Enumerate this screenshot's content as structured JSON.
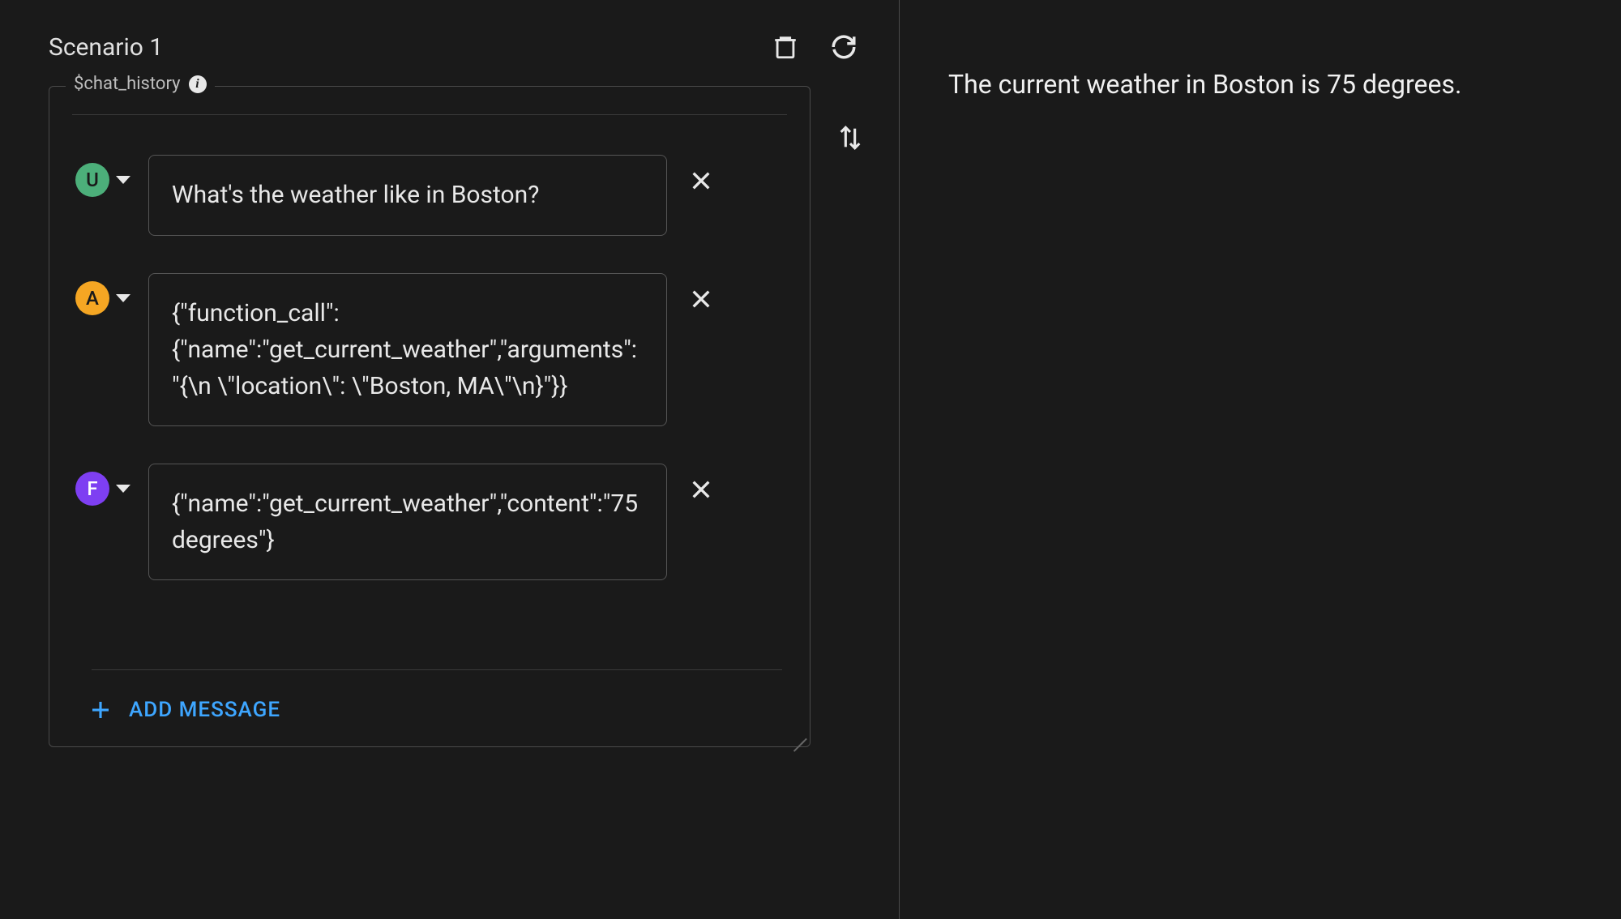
{
  "scenario": {
    "title": "Scenario 1"
  },
  "chat_history": {
    "label": "$chat_history",
    "messages": [
      {
        "role": "user",
        "role_letter": "U",
        "content": "What's the weather like in Boston?"
      },
      {
        "role": "assistant",
        "role_letter": "A",
        "content": "{\"function_call\":{\"name\":\"get_current_weather\",\"arguments\":\"{\\n  \\\"location\\\": \\\"Boston, MA\\\"\\n}\"}}"
      },
      {
        "role": "function",
        "role_letter": "F",
        "content": "{\"name\":\"get_current_weather\",\"content\":\"75 degrees\"}"
      }
    ],
    "add_message_label": "ADD MESSAGE"
  },
  "output": {
    "text": "The current weather in Boston is 75 degrees."
  }
}
